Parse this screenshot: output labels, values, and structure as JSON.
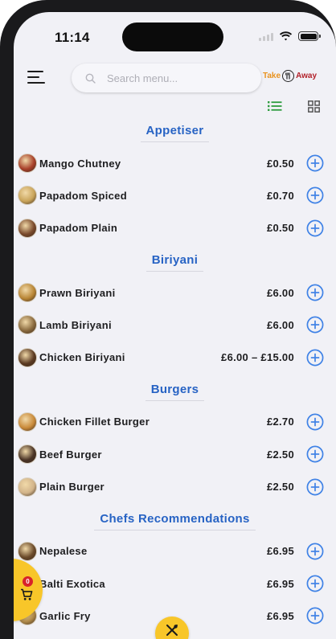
{
  "status_bar": {
    "time": "11:14"
  },
  "header": {
    "search_placeholder": "Search menu...",
    "logo_left": "Take",
    "logo_right": "Away"
  },
  "view_modes": [
    "list",
    "grid"
  ],
  "active_view": "list",
  "colors": {
    "accent_blue": "#2763c4",
    "add_button": "#3f82e6",
    "active_view_green": "#2e9c3f",
    "fab_yellow": "#f8c629",
    "badge_red": "#d8232a",
    "background": "#f1f1f6"
  },
  "categories": [
    {
      "title": "Appetiser",
      "items": [
        {
          "name": "Mango Chutney",
          "price": "£0.50",
          "thumb_color": "#a8402a"
        },
        {
          "name": "Papadom Spiced",
          "price": "£0.70",
          "thumb_color": "#c9a45a"
        },
        {
          "name": "Papadom Plain",
          "price": "£0.50",
          "thumb_color": "#7a4a2c"
        }
      ]
    },
    {
      "title": "Biriyani",
      "items": [
        {
          "name": "Prawn Biriyani",
          "price": "£6.00",
          "thumb_color": "#b98636"
        },
        {
          "name": "Lamb Biriyani",
          "price": "£6.00",
          "thumb_color": "#8a6a3e"
        },
        {
          "name": "Chicken Biriyani",
          "price": "£6.00 – £15.00",
          "thumb_color": "#5b3a22"
        }
      ]
    },
    {
      "title": "Burgers",
      "items": [
        {
          "name": "Chicken Fillet Burger",
          "price": "£2.70",
          "thumb_color": "#c98a3a"
        },
        {
          "name": "Beef Burger",
          "price": "£2.50",
          "thumb_color": "#4a3426"
        },
        {
          "name": "Plain Burger",
          "price": "£2.50",
          "thumb_color": "#d2b48a"
        }
      ]
    },
    {
      "title": "Chefs Recommendations",
      "items": [
        {
          "name": "Nepalese",
          "price": "£6.95",
          "thumb_color": "#6b4a2a"
        },
        {
          "name": "Balti Exotica",
          "price": "£6.95",
          "thumb_color": "#8c5a2e"
        },
        {
          "name": "Garlic Fry",
          "price": "£6.95",
          "thumb_color": "#b08a4a"
        }
      ]
    }
  ],
  "cart": {
    "count": "0",
    "icon": "cart-icon"
  },
  "fab": {
    "icon": "fork-knife-icon"
  }
}
